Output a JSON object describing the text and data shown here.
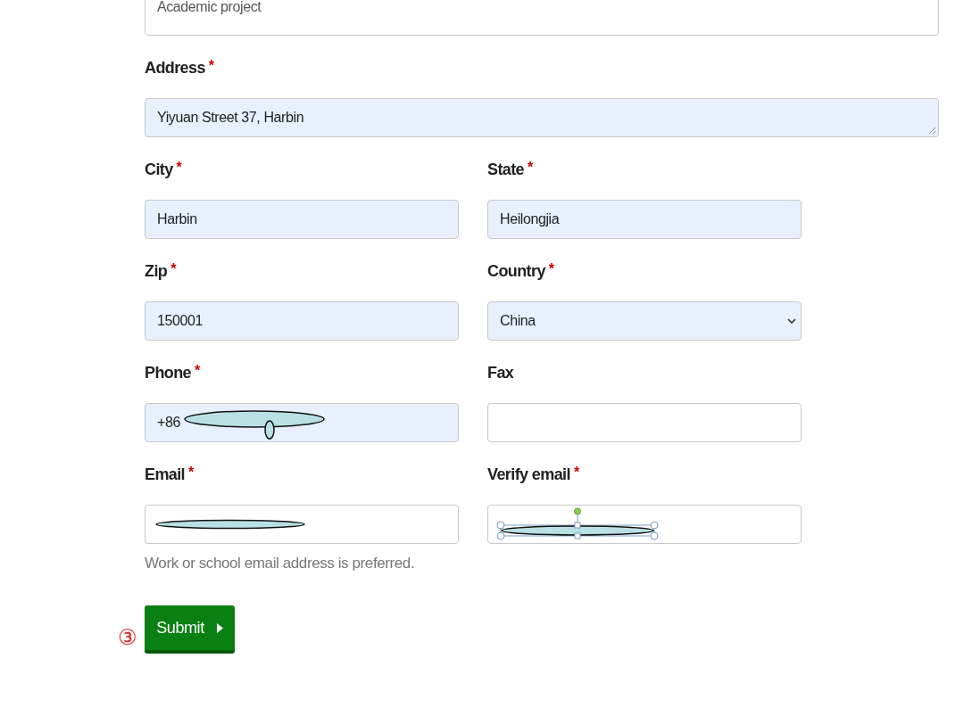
{
  "top_field": {
    "value": "Academic project"
  },
  "fields": [
    {
      "kind": "textarea",
      "label": "Address",
      "required": true,
      "value": "Yiyuan Street 37, Harbin",
      "autofilled": true
    },
    {
      "kind": "text",
      "label": "City",
      "required": true,
      "value": "Harbin",
      "autofilled": true
    },
    {
      "kind": "text",
      "label": "State",
      "required": true,
      "value": "Heilongjia",
      "autofilled": true
    },
    {
      "kind": "text",
      "label": "Zip",
      "required": true,
      "value": "150001",
      "autofilled": true
    },
    {
      "kind": "select",
      "label": "Country",
      "required": true,
      "value": "China",
      "autofilled": true
    },
    {
      "kind": "text",
      "label": "Phone",
      "required": true,
      "value": "+86",
      "autofilled": true,
      "redaction": {
        "kind": "oval-tab"
      }
    },
    {
      "kind": "text",
      "label": "Fax",
      "required": false,
      "autofilled": false
    },
    {
      "kind": "text",
      "label": "Email",
      "required": true,
      "autofilled": false,
      "redaction": {
        "kind": "oval"
      }
    },
    {
      "kind": "text",
      "label": "Verify email",
      "required": true,
      "autofilled": false,
      "redaction": {
        "kind": "selected-oval"
      }
    }
  ],
  "required_mark": "*",
  "help_text": "Work or school email address is preferred.",
  "submit": {
    "label": "Submit"
  },
  "step_marker": "③"
}
